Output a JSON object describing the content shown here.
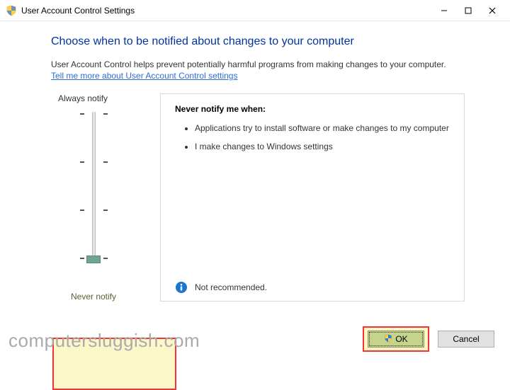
{
  "window": {
    "title": "User Account Control Settings"
  },
  "heading": "Choose when to be notified about changes to your computer",
  "subtext": "User Account Control helps prevent potentially harmful programs from making changes to your computer.",
  "link": "Tell me more about User Account Control settings",
  "slider": {
    "top_label": "Always notify",
    "bottom_label": "Never notify"
  },
  "info_panel": {
    "title": "Never notify me when:",
    "bullets": [
      "Applications try to install software or make changes to my computer",
      "I make changes to Windows settings"
    ],
    "recommendation": "Not recommended."
  },
  "buttons": {
    "ok": "OK",
    "cancel": "Cancel"
  },
  "watermark": "computersluggish.com"
}
